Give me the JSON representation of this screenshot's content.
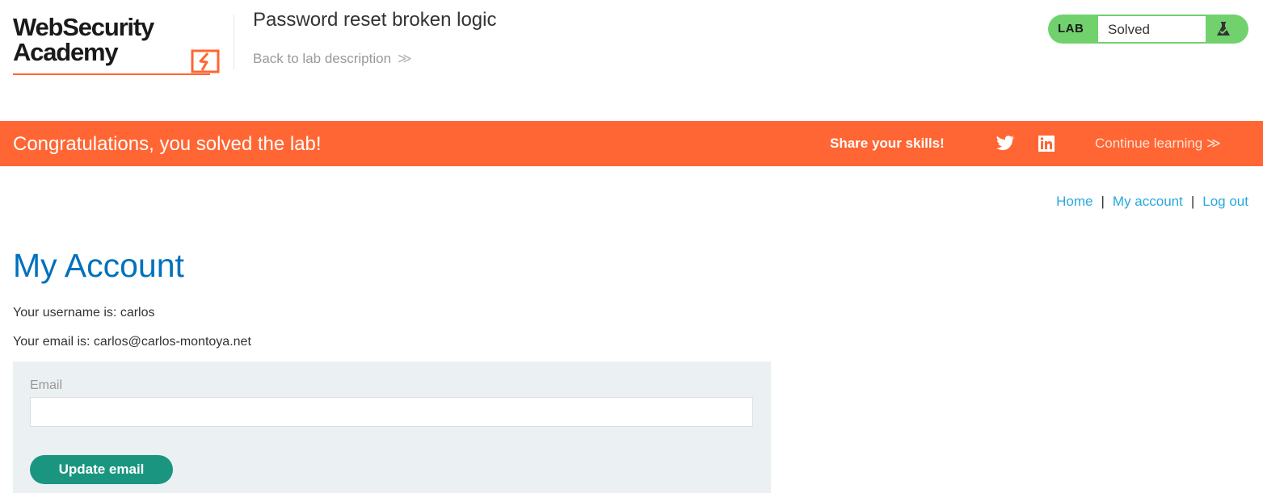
{
  "header": {
    "logo_line1": "WebSecurity",
    "logo_line2": "Academy",
    "lab_title": "Password reset broken logic",
    "back_link": "Back to lab description",
    "back_chevron": "≫",
    "lab_status": {
      "tag": "LAB",
      "status": "Solved",
      "icon": "flask-icon",
      "color": "#70d16d"
    }
  },
  "banner": {
    "message": "Congratulations, you solved the lab!",
    "share_label": "Share your skills!",
    "twitter_icon": "twitter-icon",
    "linkedin_icon": "linkedin-icon",
    "continue_label": "Continue learning ≫",
    "color": "#ff6633"
  },
  "nav": {
    "home": "Home",
    "my_account": "My account",
    "log_out": "Log out",
    "separator": "|"
  },
  "main": {
    "title": "My Account",
    "username_text": "Your username is: carlos",
    "email_text": "Your email is: carlos@carlos-montoya.net",
    "form": {
      "email_label": "Email",
      "email_value": "",
      "button_label": "Update email",
      "button_color": "#1a9680"
    }
  }
}
